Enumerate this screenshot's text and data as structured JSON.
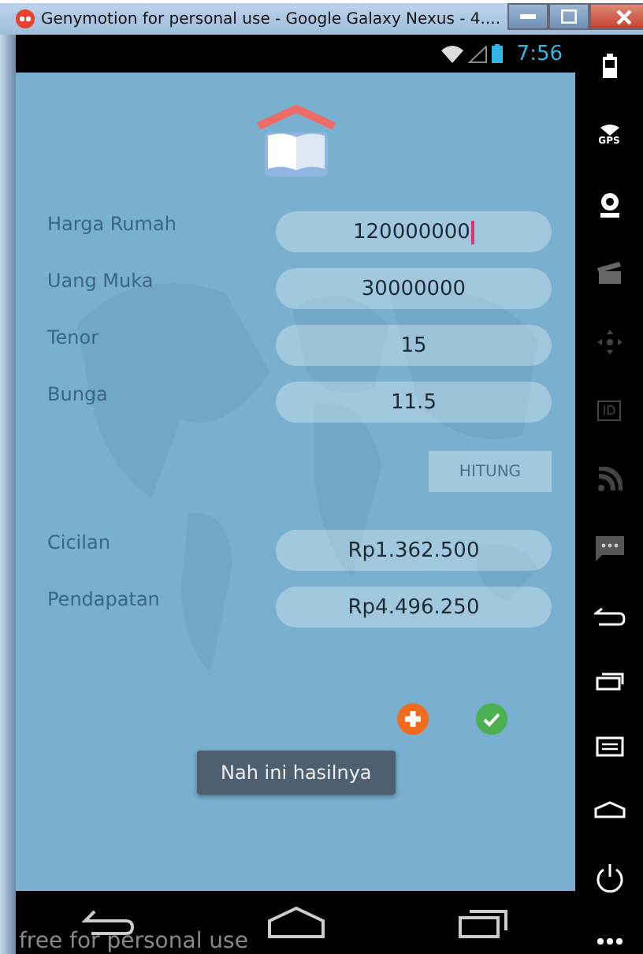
{
  "window": {
    "title": "Genymotion for personal use - Google Galaxy Nexus - 4...."
  },
  "status_bar": {
    "time": "7:56"
  },
  "inputs": [
    {
      "label": "Harga Rumah",
      "value": "120000000",
      "focused": true
    },
    {
      "label": "Uang Muka",
      "value": "30000000",
      "focused": false
    },
    {
      "label": "Tenor",
      "value": "15",
      "focused": false
    },
    {
      "label": "Bunga",
      "value": "11.5",
      "focused": false
    }
  ],
  "calculate_button": "HITUNG",
  "results": [
    {
      "label": "Cicilan",
      "value": "Rp1.362.500"
    },
    {
      "label": "Pendapatan",
      "value": "Rp4.496.250"
    }
  ],
  "toast": "Nah ini hasilnya",
  "watermark_text": "free for personal use",
  "side_toolbar": [
    {
      "kind": "battery"
    },
    {
      "kind": "gps",
      "label": "GPS"
    },
    {
      "kind": "webcam"
    },
    {
      "kind": "clapper"
    },
    {
      "kind": "dpad"
    },
    {
      "kind": "id",
      "label": "ID"
    },
    {
      "kind": "rss"
    },
    {
      "kind": "chat"
    },
    {
      "kind": "back"
    },
    {
      "kind": "recent"
    },
    {
      "kind": "menu"
    },
    {
      "kind": "home"
    },
    {
      "kind": "power"
    },
    {
      "kind": "more"
    }
  ]
}
